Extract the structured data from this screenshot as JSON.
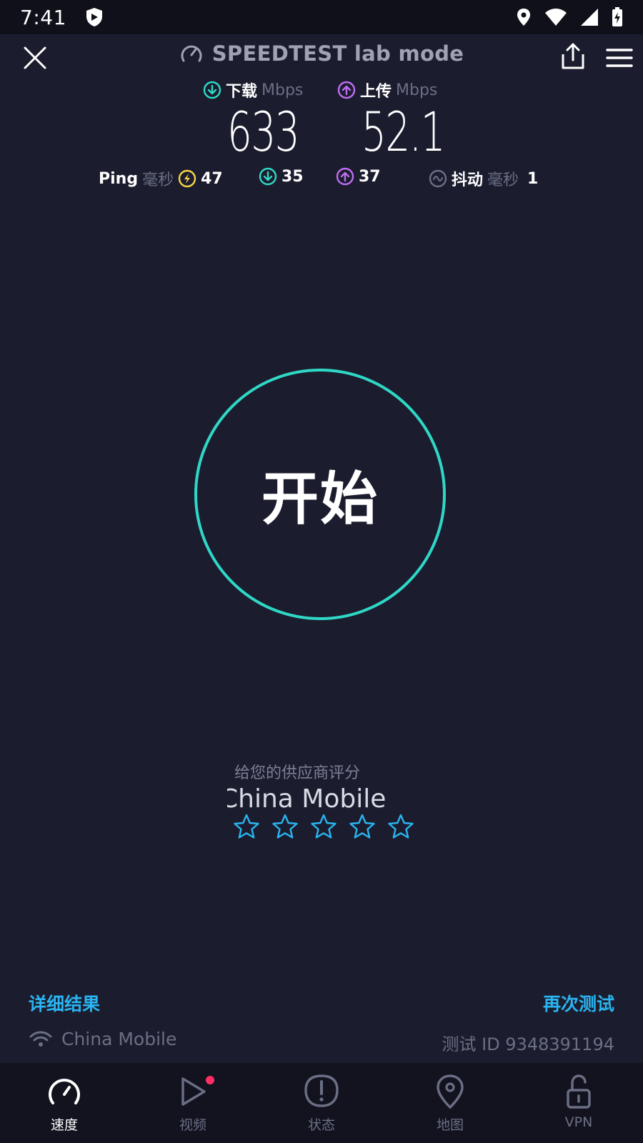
{
  "status_bar": {
    "time": "7:41"
  },
  "header": {
    "title": "SPEEDTEST lab mode"
  },
  "download": {
    "label": "下载",
    "unit": "Mbps",
    "value": "633",
    "color": "#2fd8c6"
  },
  "upload": {
    "label": "上传",
    "unit": "Mbps",
    "value": "52.1",
    "color": "#bf6cf2"
  },
  "ping": {
    "label": "Ping",
    "unit": "毫秒",
    "idle": "47",
    "download": "35",
    "upload": "37",
    "jitter_label": "抖动",
    "jitter_unit": "毫秒",
    "jitter": "1"
  },
  "start_button": {
    "label": "开始"
  },
  "rating": {
    "prompt": "给您的供应商评分",
    "provider": "China Mobile",
    "stars_max": 5,
    "stars_selected": 0
  },
  "footer": {
    "details_link": "详细结果",
    "retest_link": "再次测试",
    "isp": "China Mobile",
    "test_id": "测试 ID 9348391194"
  },
  "nav": [
    {
      "label": "速度",
      "icon": "speedometer-icon",
      "active": true
    },
    {
      "label": "视频",
      "icon": "play-icon",
      "active": false,
      "badge": true
    },
    {
      "label": "状态",
      "icon": "alert-icon",
      "active": false
    },
    {
      "label": "地图",
      "icon": "map-pin-icon",
      "active": false
    },
    {
      "label": "VPN",
      "icon": "unlock-icon",
      "active": false
    }
  ],
  "colors": {
    "background": "#1b1d2e",
    "accent_teal": "#2fd8c6",
    "accent_purple": "#bf6cf2",
    "accent_yellow": "#f5d547",
    "link_blue": "#2ab4f1"
  }
}
